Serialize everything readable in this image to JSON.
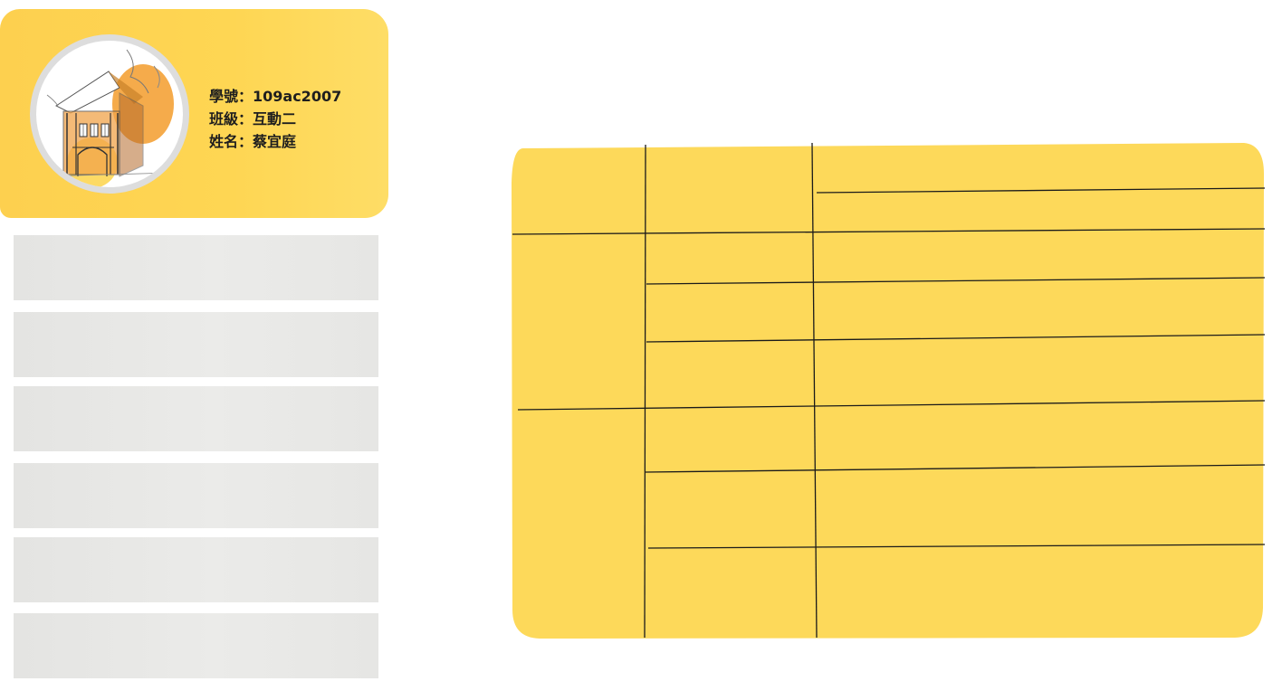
{
  "profile": {
    "student_id_line": "學號：109ac2007",
    "class_line": "班級：互動二",
    "name_line": "姓名：蔡宜庭"
  },
  "menu": {
    "items": [
      {
        "label": ""
      },
      {
        "label": ""
      },
      {
        "label": ""
      },
      {
        "label": ""
      },
      {
        "label": ""
      },
      {
        "label": ""
      }
    ]
  },
  "colors": {
    "accent_yellow": "#fdd654",
    "orange": "#f39c2c",
    "menu_gray": "#e8e8e6",
    "line": "#1a1a1a"
  }
}
